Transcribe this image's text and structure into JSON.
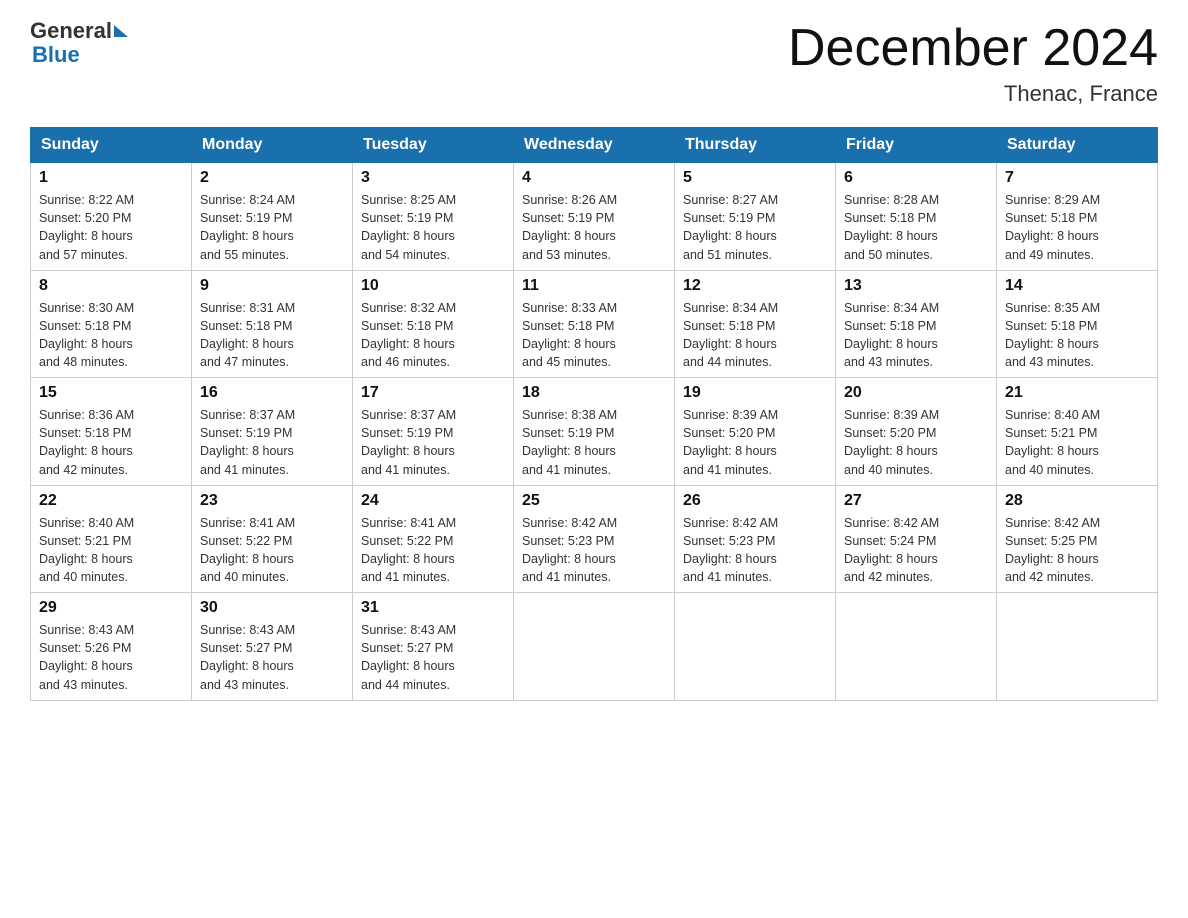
{
  "logo": {
    "general": "General",
    "blue": "Blue"
  },
  "header": {
    "month_year": "December 2024",
    "location": "Thenac, France"
  },
  "weekdays": [
    "Sunday",
    "Monday",
    "Tuesday",
    "Wednesday",
    "Thursday",
    "Friday",
    "Saturday"
  ],
  "weeks": [
    [
      {
        "day": "1",
        "sunrise": "8:22 AM",
        "sunset": "5:20 PM",
        "daylight": "8 hours and 57 minutes."
      },
      {
        "day": "2",
        "sunrise": "8:24 AM",
        "sunset": "5:19 PM",
        "daylight": "8 hours and 55 minutes."
      },
      {
        "day": "3",
        "sunrise": "8:25 AM",
        "sunset": "5:19 PM",
        "daylight": "8 hours and 54 minutes."
      },
      {
        "day": "4",
        "sunrise": "8:26 AM",
        "sunset": "5:19 PM",
        "daylight": "8 hours and 53 minutes."
      },
      {
        "day": "5",
        "sunrise": "8:27 AM",
        "sunset": "5:19 PM",
        "daylight": "8 hours and 51 minutes."
      },
      {
        "day": "6",
        "sunrise": "8:28 AM",
        "sunset": "5:18 PM",
        "daylight": "8 hours and 50 minutes."
      },
      {
        "day": "7",
        "sunrise": "8:29 AM",
        "sunset": "5:18 PM",
        "daylight": "8 hours and 49 minutes."
      }
    ],
    [
      {
        "day": "8",
        "sunrise": "8:30 AM",
        "sunset": "5:18 PM",
        "daylight": "8 hours and 48 minutes."
      },
      {
        "day": "9",
        "sunrise": "8:31 AM",
        "sunset": "5:18 PM",
        "daylight": "8 hours and 47 minutes."
      },
      {
        "day": "10",
        "sunrise": "8:32 AM",
        "sunset": "5:18 PM",
        "daylight": "8 hours and 46 minutes."
      },
      {
        "day": "11",
        "sunrise": "8:33 AM",
        "sunset": "5:18 PM",
        "daylight": "8 hours and 45 minutes."
      },
      {
        "day": "12",
        "sunrise": "8:34 AM",
        "sunset": "5:18 PM",
        "daylight": "8 hours and 44 minutes."
      },
      {
        "day": "13",
        "sunrise": "8:34 AM",
        "sunset": "5:18 PM",
        "daylight": "8 hours and 43 minutes."
      },
      {
        "day": "14",
        "sunrise": "8:35 AM",
        "sunset": "5:18 PM",
        "daylight": "8 hours and 43 minutes."
      }
    ],
    [
      {
        "day": "15",
        "sunrise": "8:36 AM",
        "sunset": "5:18 PM",
        "daylight": "8 hours and 42 minutes."
      },
      {
        "day": "16",
        "sunrise": "8:37 AM",
        "sunset": "5:19 PM",
        "daylight": "8 hours and 41 minutes."
      },
      {
        "day": "17",
        "sunrise": "8:37 AM",
        "sunset": "5:19 PM",
        "daylight": "8 hours and 41 minutes."
      },
      {
        "day": "18",
        "sunrise": "8:38 AM",
        "sunset": "5:19 PM",
        "daylight": "8 hours and 41 minutes."
      },
      {
        "day": "19",
        "sunrise": "8:39 AM",
        "sunset": "5:20 PM",
        "daylight": "8 hours and 41 minutes."
      },
      {
        "day": "20",
        "sunrise": "8:39 AM",
        "sunset": "5:20 PM",
        "daylight": "8 hours and 40 minutes."
      },
      {
        "day": "21",
        "sunrise": "8:40 AM",
        "sunset": "5:21 PM",
        "daylight": "8 hours and 40 minutes."
      }
    ],
    [
      {
        "day": "22",
        "sunrise": "8:40 AM",
        "sunset": "5:21 PM",
        "daylight": "8 hours and 40 minutes."
      },
      {
        "day": "23",
        "sunrise": "8:41 AM",
        "sunset": "5:22 PM",
        "daylight": "8 hours and 40 minutes."
      },
      {
        "day": "24",
        "sunrise": "8:41 AM",
        "sunset": "5:22 PM",
        "daylight": "8 hours and 41 minutes."
      },
      {
        "day": "25",
        "sunrise": "8:42 AM",
        "sunset": "5:23 PM",
        "daylight": "8 hours and 41 minutes."
      },
      {
        "day": "26",
        "sunrise": "8:42 AM",
        "sunset": "5:23 PM",
        "daylight": "8 hours and 41 minutes."
      },
      {
        "day": "27",
        "sunrise": "8:42 AM",
        "sunset": "5:24 PM",
        "daylight": "8 hours and 42 minutes."
      },
      {
        "day": "28",
        "sunrise": "8:42 AM",
        "sunset": "5:25 PM",
        "daylight": "8 hours and 42 minutes."
      }
    ],
    [
      {
        "day": "29",
        "sunrise": "8:43 AM",
        "sunset": "5:26 PM",
        "daylight": "8 hours and 43 minutes."
      },
      {
        "day": "30",
        "sunrise": "8:43 AM",
        "sunset": "5:27 PM",
        "daylight": "8 hours and 43 minutes."
      },
      {
        "day": "31",
        "sunrise": "8:43 AM",
        "sunset": "5:27 PM",
        "daylight": "8 hours and 44 minutes."
      },
      null,
      null,
      null,
      null
    ]
  ],
  "labels": {
    "sunrise": "Sunrise:",
    "sunset": "Sunset:",
    "daylight": "Daylight:"
  },
  "colors": {
    "header_bg": "#1a6fad",
    "border": "#aaa"
  }
}
